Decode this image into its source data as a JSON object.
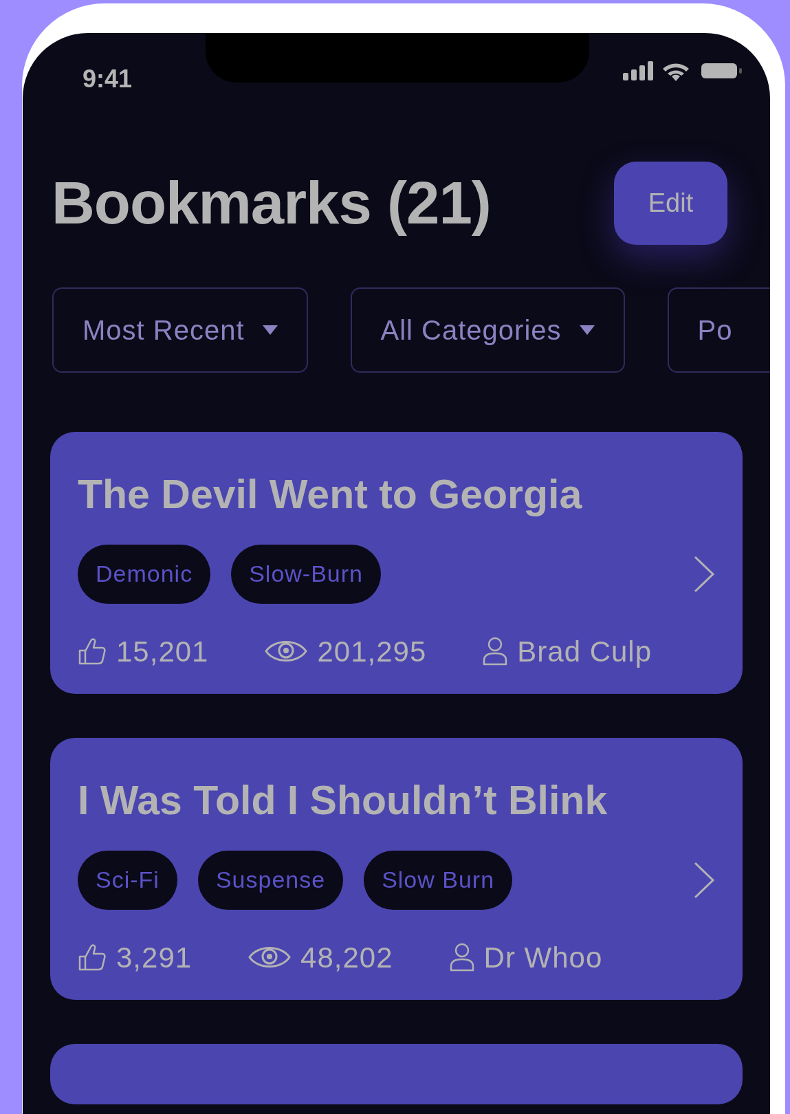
{
  "status_bar": {
    "time": "9:41"
  },
  "header": {
    "title": "Bookmarks (21)",
    "edit_button": "Edit"
  },
  "filters": [
    {
      "label": "Most Recent",
      "dropdown": true
    },
    {
      "label": "All Categories",
      "dropdown": true
    },
    {
      "label": "Po",
      "dropdown": false
    }
  ],
  "bookmarks": [
    {
      "title": "The Devil Went to Georgia",
      "tags": [
        "Demonic",
        "Slow-Burn"
      ],
      "likes": "15,201",
      "views": "201,295",
      "author": "Brad Culp"
    },
    {
      "title": "I Was Told I Shouldn’t Blink",
      "tags": [
        "Sci-Fi",
        "Suspense",
        "Slow Burn"
      ],
      "likes": "3,291",
      "views": "48,202",
      "author": "Dr Whoo"
    }
  ]
}
